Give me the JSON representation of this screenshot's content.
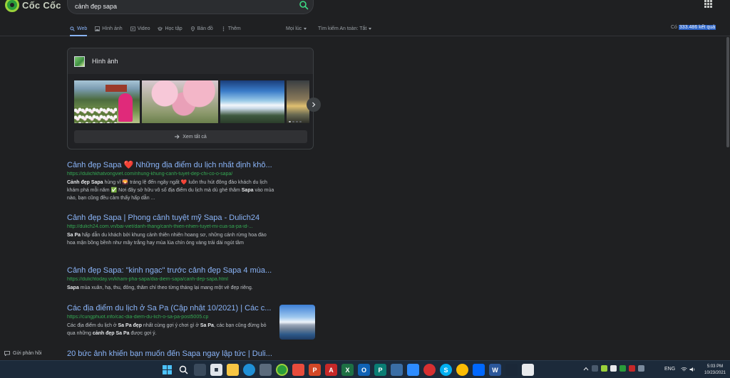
{
  "brand": {
    "name": "Cốc Cốc"
  },
  "search": {
    "query": "cảnh đẹp sapa"
  },
  "nav": {
    "tabs": [
      {
        "label": "Web",
        "icon": "search-icon",
        "active": true
      },
      {
        "label": "Hình ảnh",
        "icon": "image-icon"
      },
      {
        "label": "Video",
        "icon": "video-icon"
      },
      {
        "label": "Học tập",
        "icon": "graduation-cap-icon"
      },
      {
        "label": "Bản đồ",
        "icon": "map-pin-icon"
      },
      {
        "label": "Thêm",
        "icon": "more-vertical-icon"
      }
    ],
    "time_filter": "Mọi lúc",
    "safe_search": "Tìm kiếm An toàn: Tắt",
    "result_count_prefix": "Có",
    "result_count": "333.486 kết quả"
  },
  "images": {
    "title": "Hình ảnh",
    "see_all": "Xem tất cả"
  },
  "results": [
    {
      "title": "Cảnh đẹp Sapa ❤️ Những địa điểm du lịch nhất định khô...",
      "url": "https://dulichkhatvongviet.com/nhung-khung-canh-tuyet-dep-chi-co-o-sapa/",
      "s1": "Cảnh đẹp Sapa",
      "s2": " hùng vĩ 🌄 tráng lệ đến ngây ngất ❤️ luôn thu hút đông đảo khách du lịch khám phá mỗi năm ✅ Nơi đây sở hữu vô số địa điểm du lịch mà dù ghé thăm ",
      "s3": "Sapa",
      "s4": " vào mùa nào, bạn cũng đều cảm thấy hấp dẫn ..."
    },
    {
      "title": "Cảnh đẹp Sapa | Phong cảnh tuyệt mỹ Sapa - Dulich24",
      "url": "http://dulich24.com.vn/bai-viet/danh-thang/canh-thien-nhien-tuyet-mi-cua-sa-pa-id-...",
      "s1": "Sa Pa",
      "s2": " hấp dẫn du khách bởi khung cảnh thiên nhiên hoang sơ, những cánh rừng hoa đào hoa mận bồng bềnh như mây trắng hay mùa lúa chín óng vàng trải dài ngút tầm"
    },
    {
      "title": "Cảnh đẹp Sapa: \"kinh ngạc\" trước cảnh đẹp Sapa 4 mùa...",
      "url": "https://dulichtoday.vn/kham-pha-sapa/dia-diem-sapa/canh-dep-sapa.html",
      "s1": "Sapa",
      "s2": " mùa xuân, hạ, thu, đông, thăm chí theo từng tháng lại mang một vẻ đẹp riêng."
    },
    {
      "title": "Các địa điểm du lịch ở Sa Pa (Cập nhật 10/2021) | Các c...",
      "url": "https://cungphuot.info/cac-dia-diem-du-lich-o-sa-pa-post5005.cp",
      "s1": "Các địa điểm du lịch ở ",
      "s2": "Sa Pa đẹp",
      "s3": " nhất cùng gợi ý chơi gì ở ",
      "s4": "Sa Pa",
      "s5": ", các bạn cũng đừng bỏ qua những ",
      "s6": "cảnh đẹp Sa Pa",
      "s7": " được gợi ý."
    },
    {
      "title": "20 bức ảnh khiến bạn muốn đến Sapa ngay lập tức | Duli..."
    }
  ],
  "feedback": {
    "label": "Gửi phản hồi"
  },
  "taskbar": {
    "language": "ENG",
    "time": "5:03 PM",
    "date": "10/23/2021"
  },
  "colors": {
    "background": "#1f2022",
    "link": "#8ab4f8",
    "url": "#34a853",
    "highlight": "#2a62c6",
    "taskbar": "#1c2a3a"
  }
}
